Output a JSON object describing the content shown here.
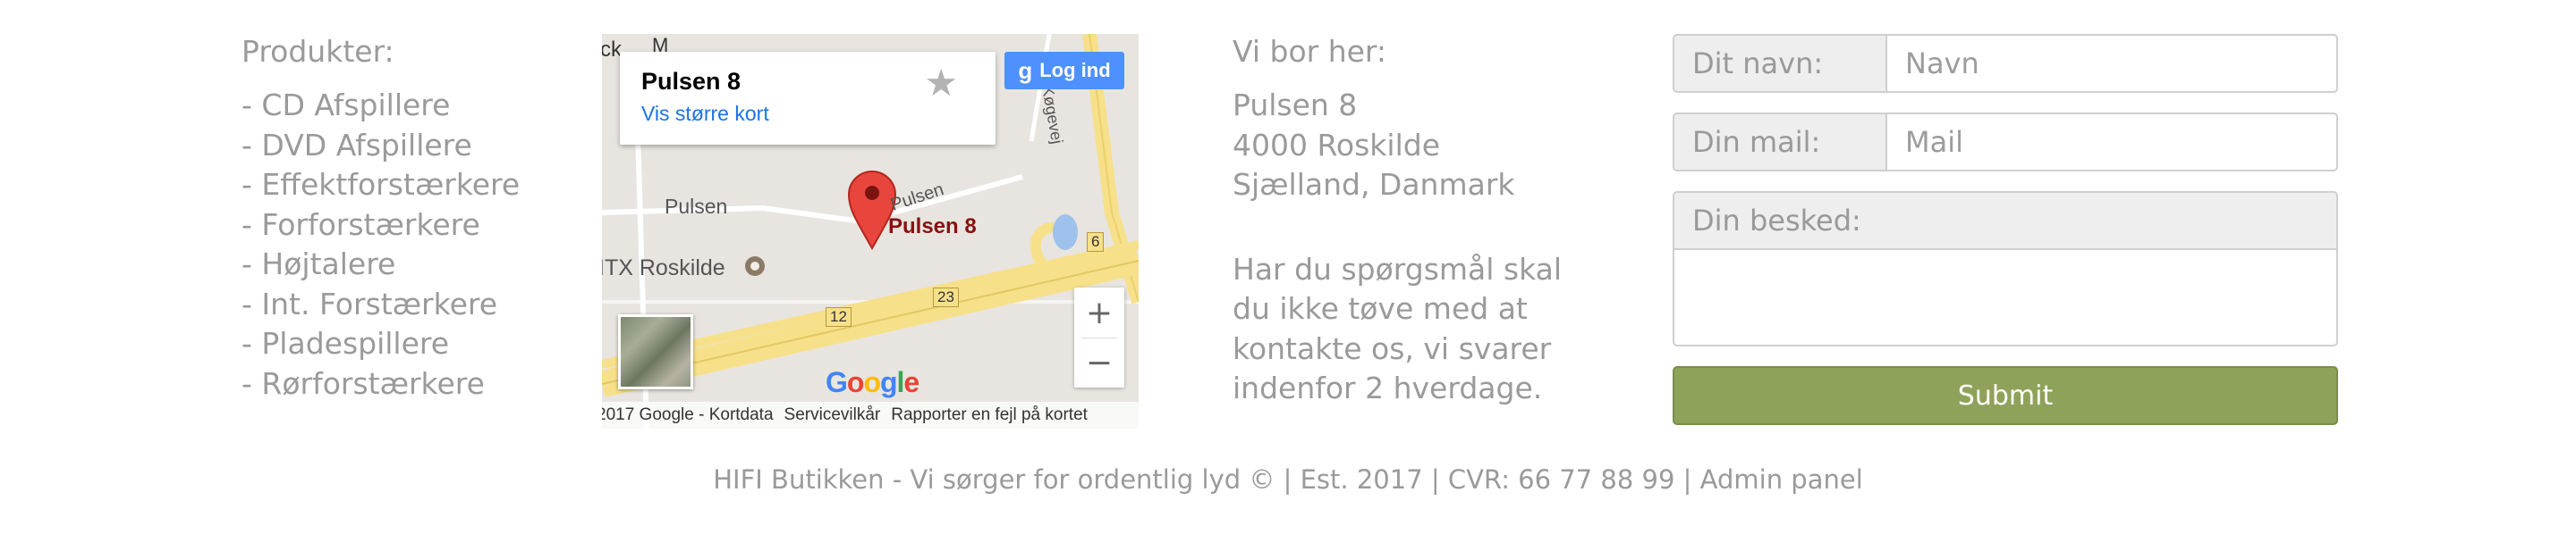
{
  "products": {
    "heading": "Produkter:",
    "items": [
      "- CD Afspillere",
      "- DVD Afspillere",
      "- Effektforstærkere",
      "- Forforstærkere",
      "- Højtalere",
      "- Int. Forstærkere",
      "- Pladespillere",
      "- Rørforstærkere"
    ]
  },
  "map": {
    "place_name": "Pulsen 8",
    "larger_map_link": "Vis større kort",
    "login_label": "Log ind",
    "pin_label": "Pulsen 8",
    "street_labels": [
      "Pulsen",
      "Pulsen",
      "Køgevej"
    ],
    "poi_label": "ITX Roskilde",
    "road_shields": [
      "12",
      "23",
      "6"
    ],
    "zoom_in": "+",
    "zoom_out": "−",
    "logo_letters": [
      "G",
      "o",
      "o",
      "g",
      "l",
      "e"
    ],
    "logo_colors": [
      "#4285f4",
      "#ea4335",
      "#fbbc05",
      "#4285f4",
      "#34a853",
      "#ea4335"
    ],
    "attribution": [
      "2017 Google - Kortdata",
      "Servicevilkår",
      "Rapporter en fejl på kortet"
    ],
    "top_left_fragment": [
      "ck",
      "M"
    ],
    "icons": [
      "star-icon",
      "google-plus-icon",
      "map-pin-icon",
      "poi-icon"
    ]
  },
  "address": {
    "heading": "Vi bor her:",
    "lines": [
      "Pulsen 8",
      "4000 Roskilde",
      "Sjælland, Danmark"
    ],
    "question_lines": [
      "Har du spørgsmål skal",
      "du ikke tøve med at",
      "kontakte os, vi svarer",
      "indenfor 2 hverdage."
    ]
  },
  "form": {
    "name_label": "Dit navn:",
    "name_placeholder": "Navn",
    "mail_label": "Din mail:",
    "mail_placeholder": "Mail",
    "message_label": "Din besked:",
    "submit_label": "Submit"
  },
  "footer": {
    "text": "HIFI Butikken - Vi sørger for ordentlig lyd © | Est. 2017 | CVR: 66 77 88 99 | Admin panel"
  },
  "colors": {
    "text": "#9a9a9a",
    "submit_bg": "#8ea25a",
    "addon_bg": "#eeeeee",
    "login_bg": "#4d90fe",
    "link": "#1a73e8"
  }
}
